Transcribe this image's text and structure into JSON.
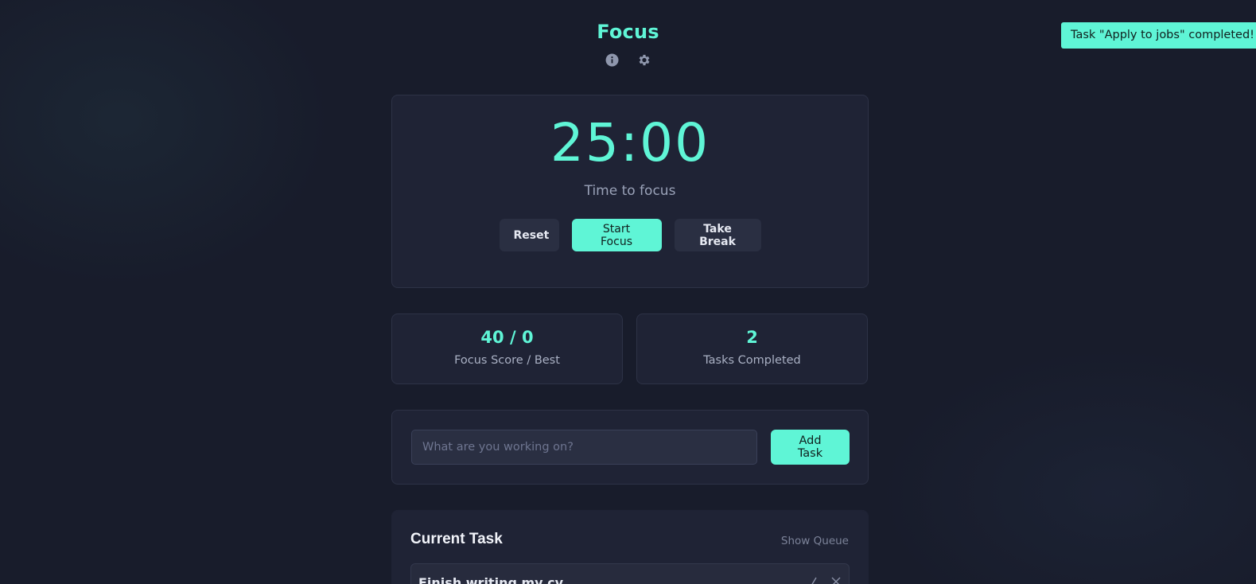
{
  "app": {
    "title": "Focus"
  },
  "header": {
    "icons": [
      "info-icon",
      "gear-icon"
    ]
  },
  "toast": {
    "message": "Task \"Apply to jobs\" completed!"
  },
  "timer": {
    "value": "25:00",
    "label": "Time to focus",
    "buttons": {
      "reset": "Reset",
      "start": "Start Focus",
      "break": "Take Break"
    }
  },
  "stats": {
    "score": {
      "value": "40 / 0",
      "label": "Focus Score / Best"
    },
    "tasks": {
      "value": "2",
      "label": "Tasks Completed"
    }
  },
  "add_task": {
    "placeholder": "What are you working on?",
    "value": "",
    "button": "Add Task"
  },
  "current_task": {
    "title": "Current Task",
    "show_queue": "Show Queue",
    "task": {
      "text": "Finish writing my cv",
      "edit_icon": "edit-icon",
      "delete_icon": "close-icon"
    }
  },
  "colors": {
    "accent": "#5ff5d6",
    "background": "#181c2b",
    "card": "#1f2335"
  }
}
